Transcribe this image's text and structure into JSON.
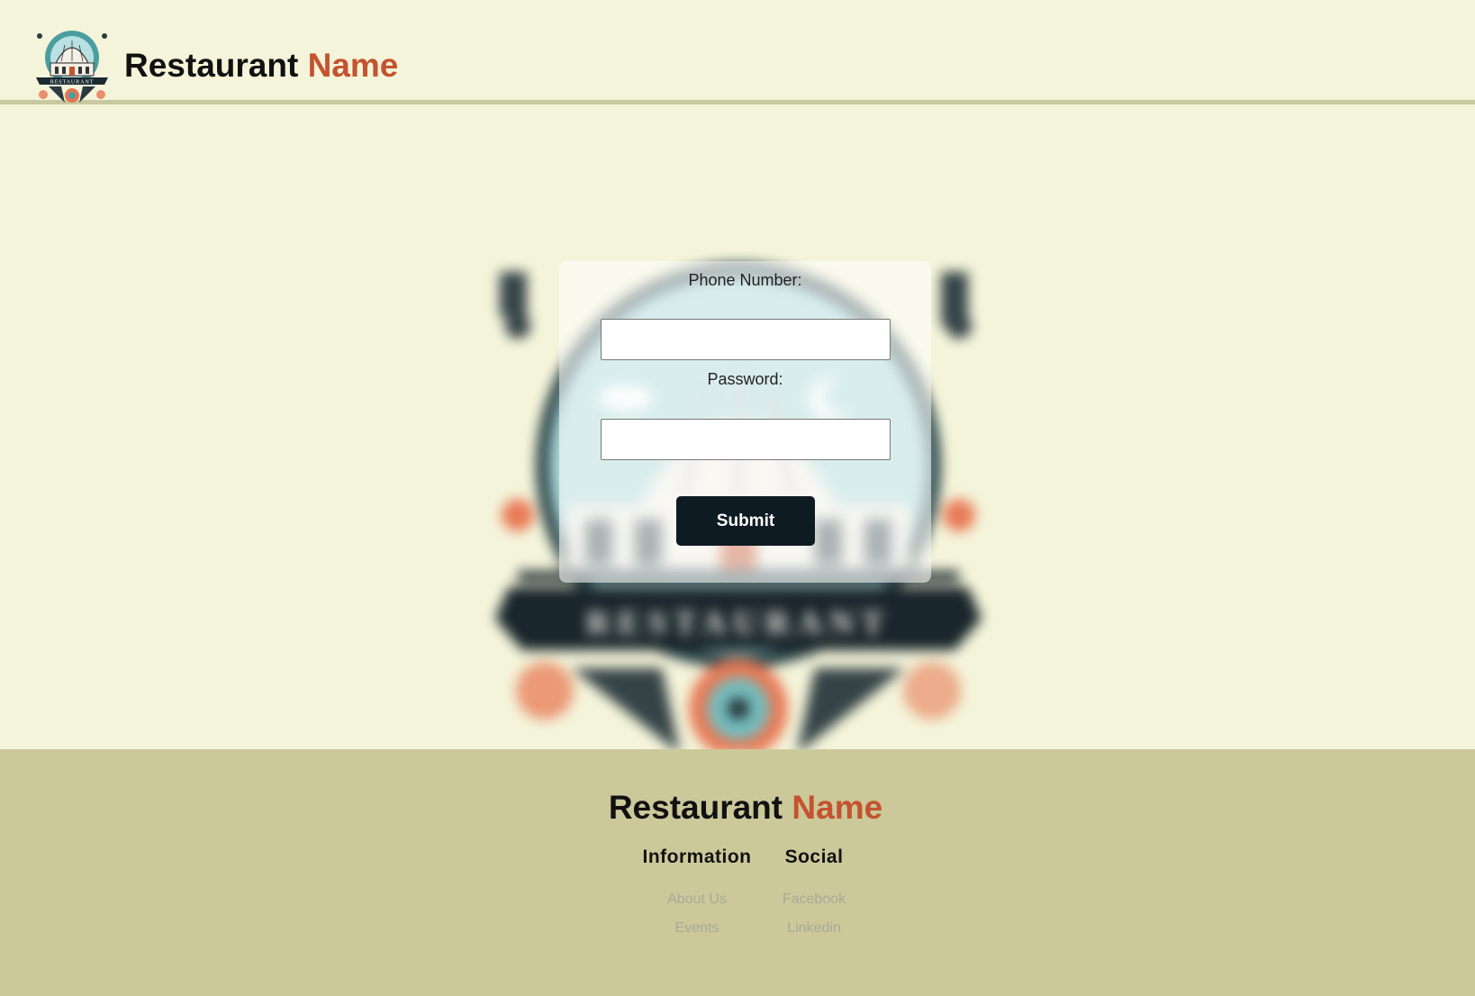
{
  "header": {
    "brand_word1": "Restaurant",
    "brand_word2": "Name",
    "logo_text": "RESTAURANT"
  },
  "login": {
    "phone_label": "Phone Number:",
    "phone_value": "",
    "password_label": "Password:",
    "password_value": "",
    "submit_label": "Submit"
  },
  "background": {
    "emblem_text": "RESTAURANT"
  },
  "footer": {
    "brand_word1": "Restaurant",
    "brand_word2": "Name",
    "columns": [
      {
        "title": "Information",
        "links": [
          "About Us",
          "Events"
        ]
      },
      {
        "title": "Social",
        "links": [
          "Facebook",
          "Linkedin"
        ]
      }
    ]
  },
  "colors": {
    "background": "#f4f4da",
    "footer": "#cbc99a",
    "accent": "#c4532f",
    "button": "#0e1b22",
    "teal": "#4a9ea0"
  }
}
